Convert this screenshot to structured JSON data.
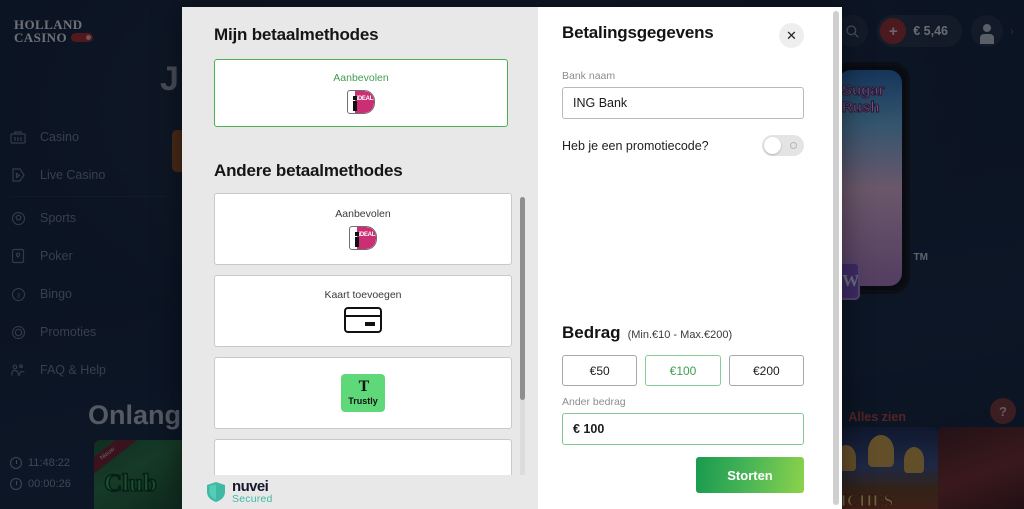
{
  "site": {
    "brand": {
      "line1": "HOLLAND",
      "line2": "CASINO"
    },
    "header": {
      "search_icon": "search-icon",
      "balance": "€ 5,46",
      "add_funds": "+",
      "account_icon": "avatar-icon",
      "chevron": "›"
    },
    "sidebar": [
      {
        "label": "Casino",
        "icon": "casino-icon"
      },
      {
        "label": "Live Casino",
        "icon": "live-casino-icon"
      },
      {
        "label": "Sports",
        "icon": "sports-icon"
      },
      {
        "label": "Poker",
        "icon": "poker-icon"
      },
      {
        "label": "Bingo",
        "icon": "bingo-icon"
      },
      {
        "label": "Promoties",
        "icon": "promoties-icon"
      },
      {
        "label": "FAQ & Help",
        "icon": "faq-help-icon"
      }
    ],
    "hero_title": "J",
    "section_title": "Onlangs",
    "see_all": "Alles zien",
    "help_label": "?",
    "clock_time": "11:48:22",
    "session_time": "00:00:26",
    "tiles": {
      "club": {
        "ribbon": "Nieuw",
        "name": "Club"
      },
      "safari": {
        "name": "RICHES"
      },
      "phone": {
        "name": "Sugar Rush"
      },
      "new_badge": "NEW",
      "tm": "TM"
    }
  },
  "modal": {
    "left": {
      "my_methods_title": "Mijn betaalmethodes",
      "other_methods_title": "Andere betaalmethodes",
      "my_methods": [
        {
          "label": "Aanbevolen",
          "icon": "ideal-logo",
          "recommended": true
        }
      ],
      "other_methods": [
        {
          "label": "Aanbevolen",
          "icon": "ideal-logo"
        },
        {
          "label": "Kaart toevoegen",
          "icon": "credit-card-icon"
        },
        {
          "label": "",
          "icon": "trustly-logo"
        }
      ],
      "trustly_name": "Trustly",
      "footer": {
        "brand": "nuvei",
        "tagline": "Secured",
        "icon": "shield-icon"
      }
    },
    "right": {
      "title": "Betalingsgegevens",
      "close_label": "✕",
      "bank_label": "Bank naam",
      "bank_value": "ING Bank",
      "bank_placeholder": "Bank naam",
      "promo_label": "Heb je een promotiecode?",
      "promo_enabled": false,
      "amount_title": "Bedrag",
      "amount_range": "(Min.€10 - Max.€200)",
      "chips": [
        {
          "label": "€50",
          "selected": false
        },
        {
          "label": "€100",
          "selected": true
        },
        {
          "label": "€200",
          "selected": false
        }
      ],
      "custom_label": "Ander bedrag",
      "custom_value": "€ 100",
      "custom_placeholder": "Ander bedrag",
      "deposit_label": "Storten"
    }
  },
  "colors": {
    "accent_green": "#4caf50",
    "brand_red": "#b02d2d",
    "ideal_pink": "#cc2e74",
    "trustly_green": "#5fd87a",
    "nuvei_teal": "#3fb9a5",
    "site_navy": "#16243a"
  }
}
